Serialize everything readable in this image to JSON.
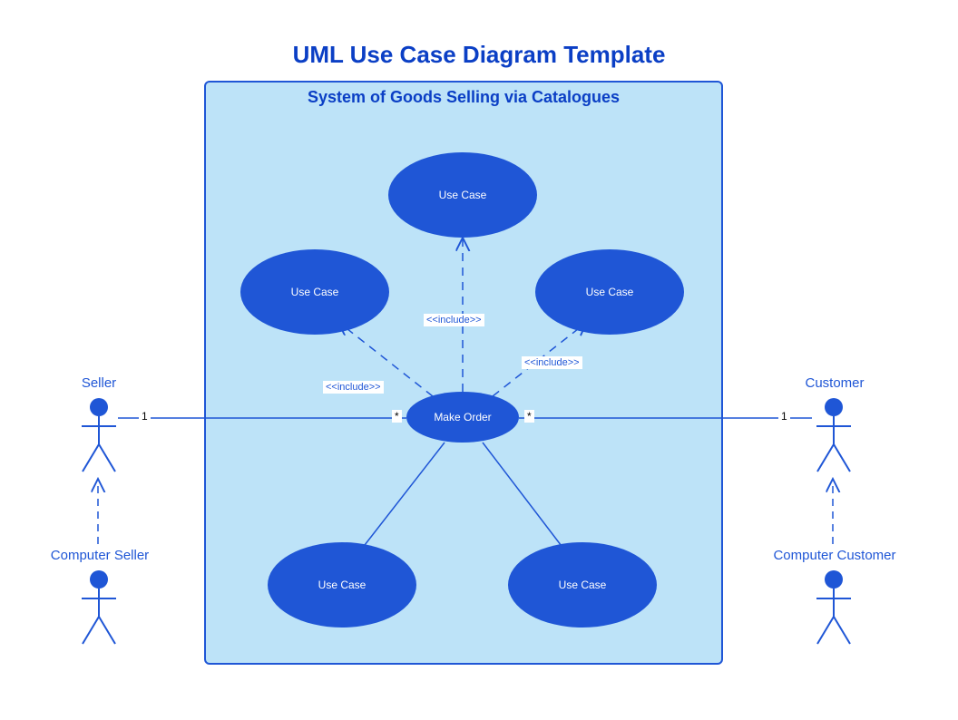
{
  "title": "UML Use Case Diagram Template",
  "system": {
    "title": "System of Goods Selling via Catalogues"
  },
  "usecases": {
    "center": "Make Order",
    "top": "Use Case",
    "topLeft": "Use Case",
    "topRight": "Use Case",
    "bottomLeft": "Use Case",
    "bottomRight": "Use Case"
  },
  "actors": {
    "seller": "Seller",
    "computerSeller": "Computer Seller",
    "customer": "Customer",
    "computerCustomer": "Computer Customer"
  },
  "stereotypes": {
    "inc1": "<<include>>",
    "inc2": "<<include>>",
    "inc3": "<<include>>"
  },
  "multiplicities": {
    "sellerNear": "1",
    "centerLeftFar": "*",
    "centerRightFar": "*",
    "customerNear": "1"
  }
}
